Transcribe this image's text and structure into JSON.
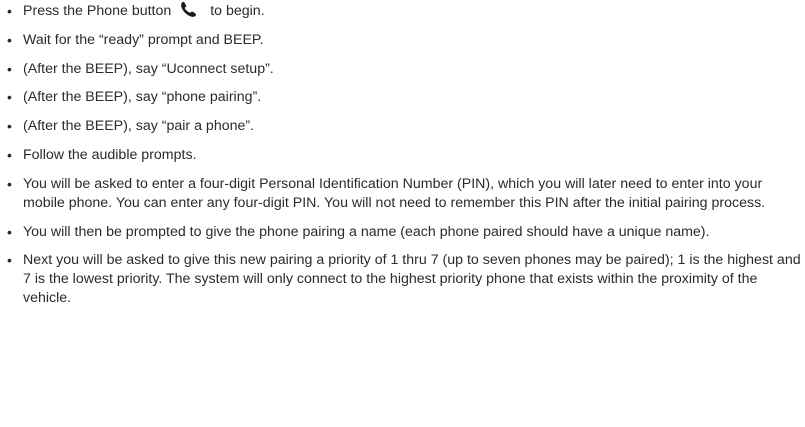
{
  "steps": [
    {
      "text_before": "Press the Phone button",
      "icon": "phone-icon",
      "text_after": "to begin."
    },
    {
      "text": "Wait for the “ready” prompt and BEEP."
    },
    {
      "text": "(After the BEEP), say “Uconnect setup”."
    },
    {
      "text": "(After the BEEP), say “phone pairing”."
    },
    {
      "text": "(After the BEEP), say “pair a phone”."
    },
    {
      "text": "Follow the audible prompts."
    },
    {
      "text": "You will be asked to enter a four-digit Personal Identification Number (PIN), which you will later need to enter into your mobile phone. You can enter any four-digit PIN. You will not need to remember this PIN after the initial pairing process."
    },
    {
      "text": "You will then be prompted to give the phone pairing a name (each phone paired should have a unique name)."
    },
    {
      "text": "Next you will be asked to give this new pairing a priority of 1 thru 7 (up to seven phones may be paired); 1 is the highest and 7 is the lowest priority. The system will only connect to the highest priority phone that exists within the proximity of the vehicle."
    }
  ],
  "bullet_char": "•"
}
